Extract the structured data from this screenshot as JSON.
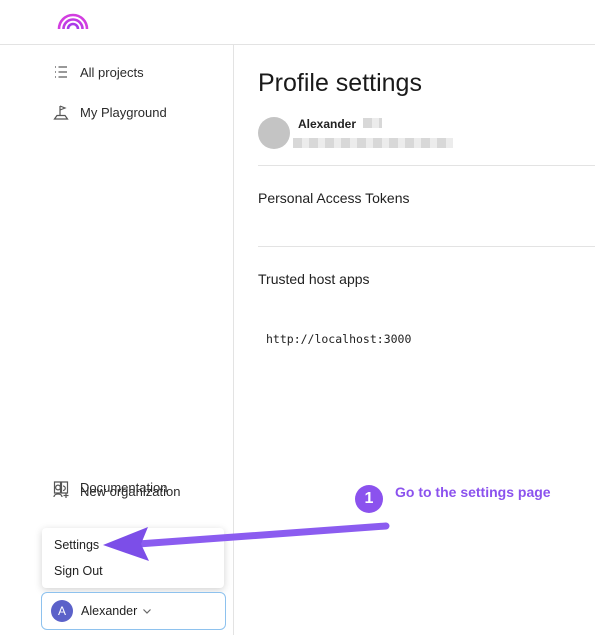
{
  "sidebar": {
    "items": [
      {
        "label": "All projects",
        "icon": "list-icon"
      },
      {
        "label": "My Playground",
        "icon": "flag-icon"
      },
      {
        "label": "New organization",
        "icon": "people-add-icon"
      },
      {
        "label": "Documentation",
        "icon": "book-icon"
      }
    ]
  },
  "profile": {
    "title": "Profile settings",
    "name": "Alexander"
  },
  "sections": {
    "tokens": "Personal Access Tokens",
    "trusted_hosts": "Trusted host apps",
    "hosts": [
      "http://localhost:3000"
    ]
  },
  "menu": {
    "items": [
      "Settings",
      "Sign Out"
    ]
  },
  "user": {
    "initial": "A",
    "name": "Alexander"
  },
  "annotation": {
    "step": "1",
    "text": "Go to the settings page",
    "color": "#8b52ee"
  },
  "colors": {
    "avatar": "#5b61c9",
    "focus_border": "#8ec2ee",
    "accent": "#8b52ee"
  }
}
